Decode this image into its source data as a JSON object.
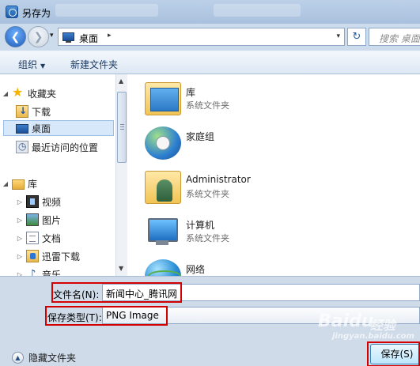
{
  "window": {
    "title": "另存为"
  },
  "nav": {
    "back_icon": "back-arrow-icon",
    "forward_icon": "forward-arrow-icon",
    "address": {
      "location": "桌面",
      "chevron": "▸",
      "dropdown": "▾"
    },
    "refresh_icon": "↻",
    "search_placeholder": "搜索 桌面"
  },
  "toolbar": {
    "organize": "组织",
    "organize_caret": "▼",
    "new_folder": "新建文件夹"
  },
  "sidebar": {
    "favorites": {
      "label": "收藏夹",
      "expander": "◢"
    },
    "favorites_items": [
      {
        "label": "下载",
        "icon": "downloads-icon"
      },
      {
        "label": "桌面",
        "icon": "desktop-icon",
        "selected": true
      },
      {
        "label": "最近访问的位置",
        "icon": "recent-places-icon"
      }
    ],
    "libraries": {
      "label": "库",
      "expander": "◢"
    },
    "library_items": [
      {
        "label": "视频",
        "expander": "▷",
        "icon": "video-library-icon"
      },
      {
        "label": "图片",
        "expander": "▷",
        "icon": "pictures-library-icon"
      },
      {
        "label": "文档",
        "expander": "▷",
        "icon": "documents-library-icon"
      },
      {
        "label": "迅雷下载",
        "expander": "▷",
        "icon": "thunder-download-icon"
      },
      {
        "label": "音乐",
        "expander": "▷",
        "icon": "music-library-icon"
      }
    ]
  },
  "scrollbar": {
    "up": "▲",
    "down": "▼"
  },
  "files": [
    {
      "name": "库",
      "type": "系统文件夹",
      "icon": "libraries-icon"
    },
    {
      "name": "家庭组",
      "type": "",
      "icon": "homegroup-icon"
    },
    {
      "name": "Administrator",
      "type": "系统文件夹",
      "icon": "user-folder-icon"
    },
    {
      "name": "计算机",
      "type": "系统文件夹",
      "icon": "computer-icon"
    },
    {
      "name": "网络",
      "type": "",
      "icon": "network-icon"
    }
  ],
  "bottom": {
    "filename_label": "文件名(N):",
    "filename_value": "新闻中心_腾讯网",
    "filetype_label": "保存类型(T):",
    "filetype_value": "PNG Image",
    "hide_folders": "隐藏文件夹",
    "save": "保存(S)"
  },
  "watermark": {
    "brand": "Baidu",
    "sub": "经验",
    "url": "jingyan.baidu.com"
  },
  "colors": {
    "highlight": "#d40000",
    "accent": "#1c5cb8",
    "selection": "#d8e8fb"
  }
}
